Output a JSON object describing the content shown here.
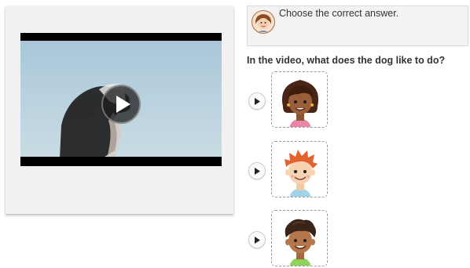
{
  "instruction": {
    "text": "Choose the correct answer.",
    "avatar_icon": "teacher-avatar-icon"
  },
  "question": {
    "text": "In the video, what does the dog like to do?"
  },
  "video": {
    "play_icon": "play-icon"
  },
  "options": [
    {
      "icon": "girl-face-icon",
      "audio_icon": "audio-play-icon"
    },
    {
      "icon": "red-haired-boy-face-icon",
      "audio_icon": "audio-play-icon"
    },
    {
      "icon": "dark-haired-boy-face-icon",
      "audio_icon": "audio-play-icon"
    }
  ],
  "colors": {
    "instruction_bg": "#f3f3f3",
    "video_sky": "#b9d2df"
  }
}
